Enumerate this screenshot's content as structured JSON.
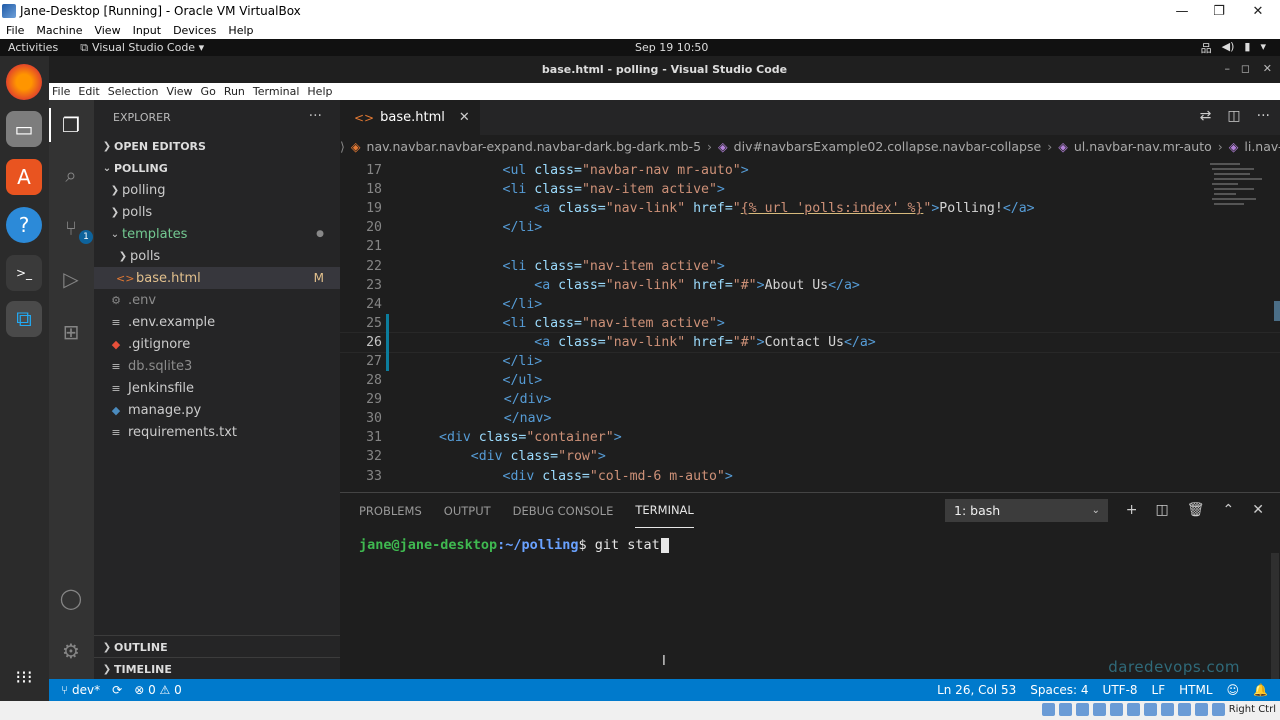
{
  "vbox": {
    "title": "Jane-Desktop [Running] - Oracle VM VirtualBox",
    "menu": [
      "File",
      "Machine",
      "View",
      "Input",
      "Devices",
      "Help"
    ],
    "host_key": "Right Ctrl"
  },
  "gnome": {
    "activities": "Activities",
    "app_name": "Visual Studio Code ▾",
    "clock": "Sep 19  10:50"
  },
  "vscode": {
    "title": "base.html - polling - Visual Studio Code",
    "menu": [
      "File",
      "Edit",
      "Selection",
      "View",
      "Go",
      "Run",
      "Terminal",
      "Help"
    ],
    "activity_badge": "1"
  },
  "sidebar": {
    "explorer_label": "EXPLORER",
    "open_editors": "OPEN EDITORS",
    "project": "POLLING",
    "tree": [
      {
        "label": "polling",
        "type": "folder",
        "depth": 1
      },
      {
        "label": "polls",
        "type": "folder",
        "depth": 1
      },
      {
        "label": "templates",
        "type": "folder-open",
        "depth": 1,
        "mark": "●"
      },
      {
        "label": "polls",
        "type": "folder",
        "depth": 2
      },
      {
        "label": "base.html",
        "type": "html",
        "depth": 2,
        "mark": "M"
      },
      {
        "label": ".env",
        "type": "gear",
        "depth": 1
      },
      {
        "label": ".env.example",
        "type": "lines",
        "depth": 1
      },
      {
        "label": ".gitignore",
        "type": "git",
        "depth": 1
      },
      {
        "label": "db.sqlite3",
        "type": "lines",
        "depth": 1
      },
      {
        "label": "Jenkinsfile",
        "type": "lines",
        "depth": 1
      },
      {
        "label": "manage.py",
        "type": "python",
        "depth": 1
      },
      {
        "label": "requirements.txt",
        "type": "lines",
        "depth": 1
      }
    ],
    "outline": "OUTLINE",
    "timeline": "TIMELINE"
  },
  "editor": {
    "tab_label": "base.html",
    "breadcrumb": [
      "nav.navbar.navbar-expand.navbar-dark.bg-dark.mb-5",
      "div#navbarsExample02.collapse.navbar-collapse",
      "ul.navbar-nav.mr-auto",
      "li.nav-item.active"
    ],
    "line_numbers": [
      "17",
      "18",
      "19",
      "20",
      "21",
      "22",
      "23",
      "24",
      "25",
      "26",
      "27",
      "28",
      "29",
      "30",
      "31",
      "32",
      "33"
    ],
    "code_lines": {
      "l17": [
        "        ",
        "<ul ",
        "class=",
        "\"navbar-nav mr-auto\"",
        ">"
      ],
      "l18": [
        "        ",
        "<li ",
        "class=",
        "\"nav-item active\"",
        ">"
      ],
      "l19": [
        "            ",
        "<a ",
        "class=",
        "\"nav-link\"",
        " href=",
        "\"",
        "{% url 'polls:index' %}",
        "\"",
        ">",
        "Polling!",
        "</a>"
      ],
      "l20": [
        "        ",
        "</li>"
      ],
      "l22": [
        "        ",
        "<li ",
        "class=",
        "\"nav-item active\"",
        ">"
      ],
      "l23": [
        "            ",
        "<a ",
        "class=",
        "\"nav-link\"",
        " href=",
        "\"#\"",
        ">",
        "About Us",
        "</a>"
      ],
      "l24": [
        "        ",
        "</li>"
      ],
      "l25": [
        "        ",
        "<li ",
        "class=",
        "\"nav-item active\"",
        ">"
      ],
      "l26": [
        "            ",
        "<a ",
        "class=",
        "\"nav-link\"",
        " href=",
        "\"#\"",
        ">",
        "Contact Us",
        "</a>"
      ],
      "l27": [
        "        ",
        "</li>"
      ],
      "l28": [
        "        ",
        "</ul>"
      ],
      "l29": [
        "    ",
        "</div>"
      ],
      "l30": [
        "    ",
        "</nav>"
      ],
      "l31": [
        "",
        "<div ",
        "class=",
        "\"container\"",
        ">"
      ],
      "l32": [
        "    ",
        "<div ",
        "class=",
        "\"row\"",
        ">"
      ],
      "l33": [
        "        ",
        "<div ",
        "class=",
        "\"col-md-6 m-auto\"",
        ">"
      ]
    }
  },
  "panel": {
    "tabs": [
      "PROBLEMS",
      "OUTPUT",
      "DEBUG CONSOLE",
      "TERMINAL"
    ],
    "terminal_select": "1: bash",
    "prompt_user": "jane@jane-desktop",
    "prompt_path": ":~/polling",
    "prompt_symbol": "$ ",
    "command": "git stat",
    "watermark": "daredevops.com"
  },
  "statusbar": {
    "branch": "dev*",
    "problems": "⊗ 0 ⚠ 0",
    "position": "Ln 26, Col 53",
    "spaces": "Spaces: 4",
    "encoding": "UTF-8",
    "eol": "LF",
    "language": "HTML"
  },
  "colors": {
    "activity_bar": "#333333",
    "sidebar": "#252526",
    "editor_bg": "#1e1e1e",
    "status_bar": "#007acc",
    "tag": "#569cd6",
    "attr": "#9cdcfe",
    "string": "#ce9178"
  }
}
